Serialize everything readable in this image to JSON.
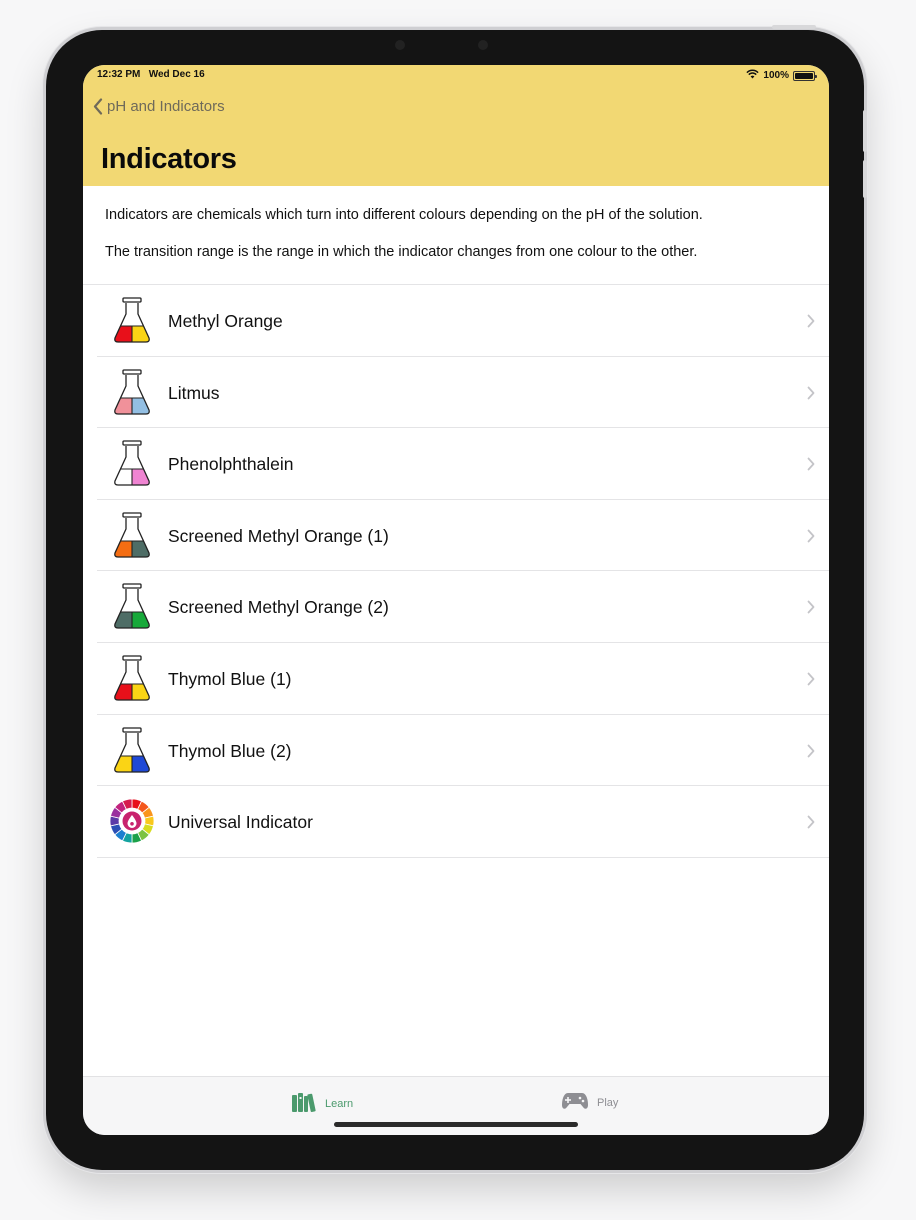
{
  "status_bar": {
    "time": "12:32 PM",
    "date": "Wed Dec 16",
    "battery": "100%"
  },
  "nav": {
    "back_label": "pH and Indicators",
    "title": "Indicators"
  },
  "intro": {
    "paragraph_1": "Indicators are chemicals which turn into different colours depending on the pH of the solution.",
    "paragraph_2": "The transition range is the range in which the indicator changes from one colour to the other."
  },
  "indicators": [
    {
      "label": "Methyl Orange",
      "icon": "flask-icon",
      "left_color": "#e8101a",
      "right_color": "#fad415"
    },
    {
      "label": "Litmus",
      "icon": "flask-icon",
      "left_color": "#f0919a",
      "right_color": "#93bfe3"
    },
    {
      "label": "Phenolphthalein",
      "icon": "flask-icon",
      "left_color": "#ffffff",
      "right_color": "#ef84d2"
    },
    {
      "label": "Screened Methyl Orange (1)",
      "icon": "flask-icon",
      "left_color": "#f46d12",
      "right_color": "#4e6d66"
    },
    {
      "label": "Screened Methyl Orange (2)",
      "icon": "flask-icon",
      "left_color": "#4e6d66",
      "right_color": "#17a93a"
    },
    {
      "label": "Thymol Blue (1)",
      "icon": "flask-icon",
      "left_color": "#e8101a",
      "right_color": "#fad415"
    },
    {
      "label": "Thymol Blue (2)",
      "icon": "flask-icon",
      "left_color": "#fad415",
      "right_color": "#1f49d6"
    },
    {
      "label": "Universal Indicator",
      "icon": "color-wheel-icon"
    }
  ],
  "tabs": [
    {
      "label": "Learn",
      "icon": "books-icon",
      "selected": true
    },
    {
      "label": "Play",
      "icon": "gamepad-icon",
      "selected": false
    }
  ],
  "colors": {
    "header": "#f2d873",
    "accent": "#4b9a6d",
    "inactive_tab": "#8e8e93"
  }
}
